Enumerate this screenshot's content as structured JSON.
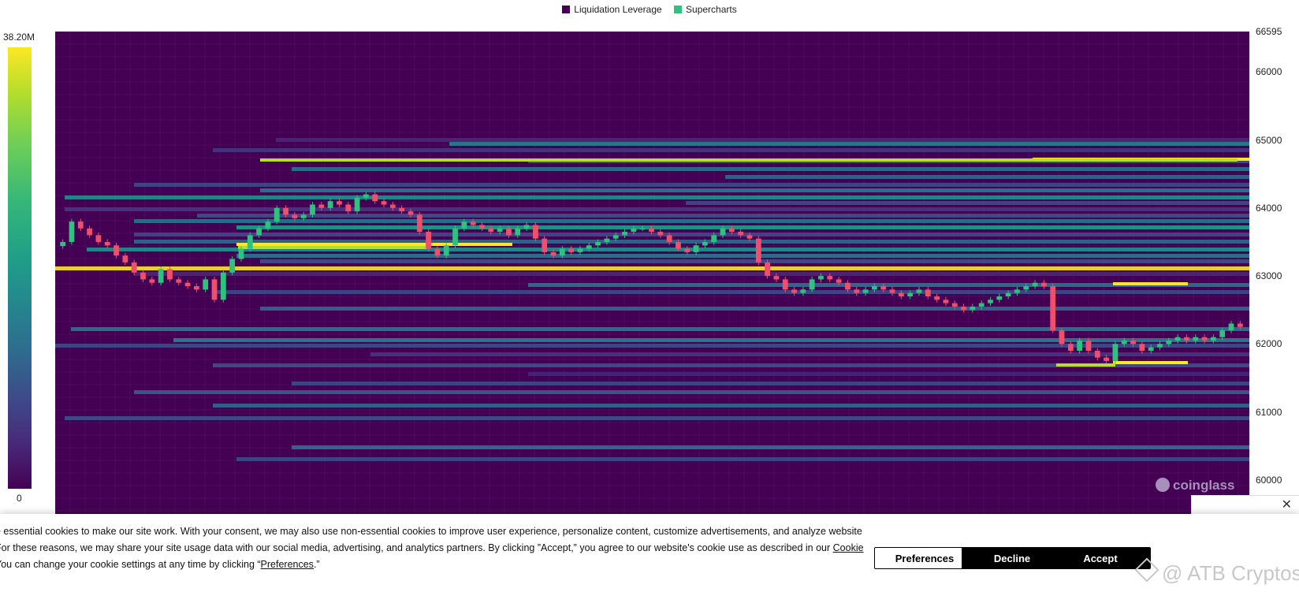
{
  "legend": [
    {
      "label": "Liquidation Leverage",
      "color": "#440154"
    },
    {
      "label": "Supercharts",
      "color": "#2ec27e"
    }
  ],
  "colorscale": {
    "max_label": "38.20M",
    "min_label": "0"
  },
  "watermark": "coinglass",
  "credit": "@ ATB Cryptos",
  "chart_data": {
    "type": "heatmap",
    "title": "",
    "xlabel": "",
    "ylabel": "",
    "ylim": [
      59500,
      66595
    ],
    "y_ticks": [
      "66595",
      "66000",
      "65000",
      "64000",
      "63000",
      "62000",
      "61000",
      "60000"
    ],
    "colorscale_range": [
      0,
      38.2
    ],
    "colorscale_unit": "M",
    "candles_close": [
      63500,
      63800,
      63700,
      63600,
      63500,
      63450,
      63300,
      63200,
      63050,
      62950,
      62900,
      63100,
      62950,
      62900,
      62850,
      62800,
      62950,
      62650,
      63050,
      63250,
      63400,
      63600,
      63700,
      63800,
      64000,
      63900,
      63850,
      63900,
      64050,
      64000,
      64100,
      64050,
      63950,
      64150,
      64200,
      64100,
      64050,
      64000,
      63950,
      63900,
      63650,
      63400,
      63300,
      63450,
      63700,
      63800,
      63750,
      63700,
      63650,
      63700,
      63600,
      63700,
      63750,
      63550,
      63350,
      63300,
      63400,
      63350,
      63400,
      63450,
      63500,
      63550,
      63600,
      63650,
      63700,
      63700,
      63650,
      63600,
      63500,
      63400,
      63350,
      63450,
      63500,
      63600,
      63700,
      63650,
      63600,
      63550,
      63200,
      63000,
      62950,
      62800,
      62750,
      62800,
      62950,
      63000,
      62950,
      62900,
      62800,
      62750,
      62800,
      62850,
      62800,
      62750,
      62700,
      62750,
      62800,
      62700,
      62650,
      62600,
      62550,
      62500,
      62550,
      62600,
      62650,
      62700,
      62750,
      62800,
      62850,
      62900,
      62850,
      62200,
      62000,
      61900,
      62050,
      61900,
      61800,
      61750,
      62000,
      62050,
      62000,
      61900,
      61950,
      62000,
      62050,
      62100,
      62050,
      62100,
      62050,
      62100,
      62200,
      62300,
      62250
    ]
  },
  "cookie": {
    "line1": "e essential cookies to make our site work. With your consent, we may also use non-essential cookies to improve user experience, personalize content, customize advertisements, and analyze website",
    "line2_pre": "For these reasons, we may share your site usage data with our social media, advertising, and analytics partners. By clicking ”Accept,” you agree to our website's cookie use as described in our ",
    "line2_link": "Cookie",
    "line3_pre": "You can change your cookie settings at any time by clicking “",
    "line3_link": "Preferences",
    "line3_post": ".”",
    "preferences_label": "Preferences",
    "decline_label": "Decline",
    "accept_label": "Accept",
    "close_symbol": "✕"
  }
}
